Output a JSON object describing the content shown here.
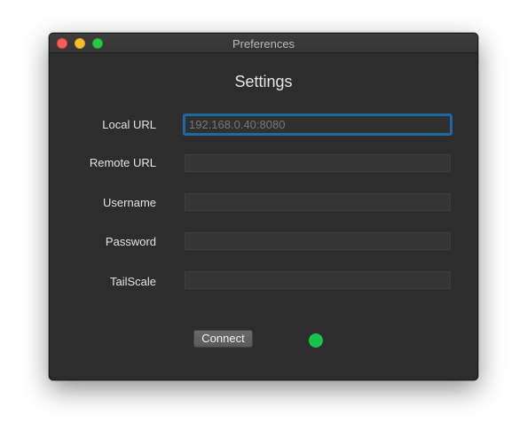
{
  "window": {
    "title": "Preferences",
    "heading": "Settings"
  },
  "form": {
    "local_url": {
      "label": "Local URL",
      "value": "",
      "placeholder": "192.168.0.40:8080"
    },
    "remote_url": {
      "label": "Remote URL",
      "value": "",
      "placeholder": ""
    },
    "username": {
      "label": "Username",
      "value": "",
      "placeholder": ""
    },
    "password": {
      "label": "Password",
      "value": "",
      "placeholder": ""
    },
    "tailscale": {
      "label": "TailScale",
      "value": "",
      "placeholder": ""
    }
  },
  "actions": {
    "connect_label": "Connect"
  },
  "status": {
    "icon": "status-dot",
    "color": "#19c34a"
  },
  "colors": {
    "window_bg": "#2d2d2d",
    "focus_ring": "#1c6aa1",
    "close": "#fe5f57",
    "minimize": "#febc2e",
    "zoom": "#28c840"
  }
}
